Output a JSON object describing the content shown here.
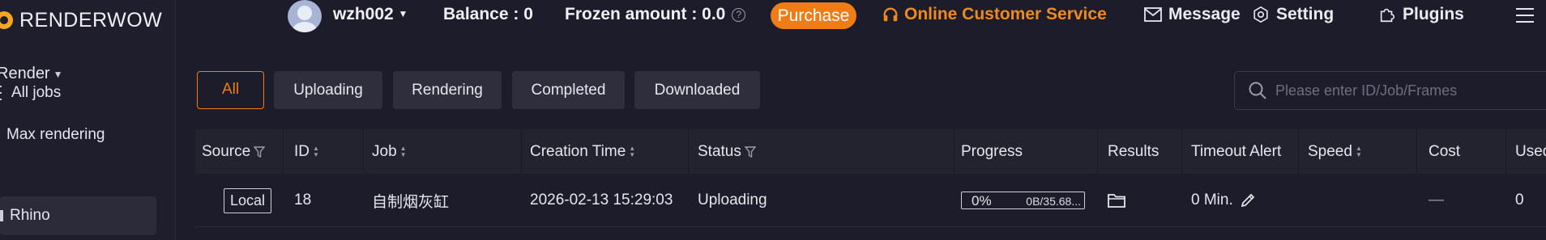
{
  "brand": {
    "name_bold": "RENDER",
    "name_light": "WOW"
  },
  "sidebar": {
    "group_label": "Render",
    "items": [
      {
        "label": "All jobs",
        "active": false
      },
      {
        "label": "Max rendering",
        "active": false
      },
      {
        "label": "Rhino",
        "active": true
      }
    ]
  },
  "header": {
    "username": "wzh002",
    "balance": "Balance : 0",
    "frozen": "Frozen amount : 0.0",
    "purchase_label": "Purchase",
    "service_label": "Online Customer Service",
    "message_label": "Message",
    "setting_label": "Setting",
    "plugins_label": "Plugins"
  },
  "filters": {
    "tabs": [
      "All",
      "Uploading",
      "Rendering",
      "Completed",
      "Downloaded"
    ],
    "active": "All"
  },
  "search": {
    "placeholder": "Please enter ID/Job/Frames",
    "value": ""
  },
  "table": {
    "columns": [
      "Source",
      "ID",
      "Job",
      "Creation Time",
      "Status",
      "Progress",
      "Results",
      "Timeout Alert",
      "Speed",
      "Cost",
      "Used"
    ],
    "rows": [
      {
        "source": "Local",
        "id": "18",
        "job": "自制烟灰缸",
        "creation_time": "2026-02-13 15:29:03",
        "status": "Uploading",
        "progress_pct": "0%",
        "progress_size": "0B/35.68...",
        "timeout_alert": "0 Min.",
        "cost": "—",
        "used": "0"
      }
    ]
  },
  "colors": {
    "accent": "#f07c16",
    "background": "#1c1c2a",
    "sidebar": "#1e1e2c"
  },
  "icons": [
    "logo-icon",
    "caret-down-icon",
    "list-icon",
    "avatar",
    "question-icon",
    "headset-icon",
    "mail-icon",
    "gear-icon",
    "puzzle-icon",
    "hamburger-icon",
    "search-icon",
    "filter-icon",
    "sort-icon",
    "folder-icon",
    "edit-icon"
  ]
}
